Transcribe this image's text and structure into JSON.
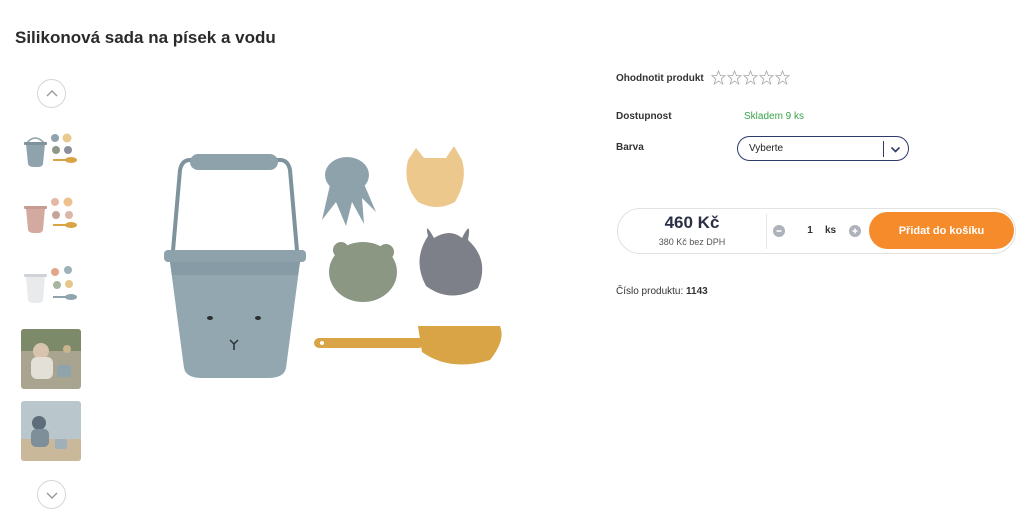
{
  "product": {
    "title": "Silikonová sada na písek a vodu"
  },
  "gallery": {
    "up_icon": "chevron-up-icon",
    "down_icon": "chevron-down-icon",
    "thumbnails": [
      {
        "desc": "blue bucket set"
      },
      {
        "desc": "pink bucket set"
      },
      {
        "desc": "white bucket set"
      },
      {
        "desc": "child playing photo"
      },
      {
        "desc": "child at beach photo"
      }
    ]
  },
  "rating": {
    "label": "Ohodnotit produkt",
    "stars_total": 5,
    "stars_filled": 0
  },
  "availability": {
    "label": "Dostupnost",
    "value": "Skladem 9 ks",
    "color": "#3aa34b"
  },
  "color_select": {
    "label": "Barva",
    "placeholder": "Vyberte"
  },
  "buy": {
    "price": "460 Kč",
    "price_without_vat": "380 Kč bez DPH",
    "quantity": "1",
    "unit": "ks",
    "add_to_cart": "Přidat do košíku",
    "accent": "#f68b2c"
  },
  "product_number": {
    "label": "Číslo produktu:",
    "value": "1143"
  }
}
